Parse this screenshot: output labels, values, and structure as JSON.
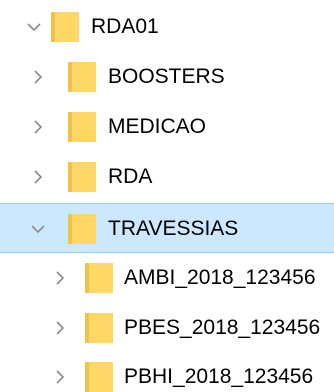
{
  "tree": {
    "root": {
      "label": "RDA01",
      "state": "expanded",
      "icon": "folder-icon",
      "chevron_icon": "chevron-down-icon"
    },
    "children": [
      {
        "label": "BOOSTERS",
        "state": "collapsed",
        "icon": "folder-icon",
        "chevron_icon": "chevron-right-icon"
      },
      {
        "label": "MEDICAO",
        "state": "collapsed",
        "icon": "folder-icon",
        "chevron_icon": "chevron-right-icon"
      },
      {
        "label": "RDA",
        "state": "collapsed",
        "icon": "folder-icon",
        "chevron_icon": "chevron-right-icon"
      },
      {
        "label": "TRAVESSIAS",
        "state": "expanded",
        "selected": true,
        "icon": "folder-icon",
        "chevron_icon": "chevron-down-icon",
        "children": [
          {
            "label": "AMBI_2018_123456",
            "state": "collapsed",
            "icon": "folder-icon",
            "chevron_icon": "chevron-right-icon"
          },
          {
            "label": "PBES_2018_123456",
            "state": "collapsed",
            "icon": "folder-icon",
            "chevron_icon": "chevron-right-icon"
          },
          {
            "label": "PBHI_2018_123456",
            "state": "collapsed",
            "icon": "folder-icon",
            "chevron_icon": "chevron-right-icon"
          }
        ]
      }
    ]
  },
  "colors": {
    "selection_bg": "#cce8ff",
    "selection_border": "#99d1ff",
    "folder_fill": "#ffd766",
    "folder_dark": "#f0c24a",
    "chevron": "#8a8a8a"
  }
}
